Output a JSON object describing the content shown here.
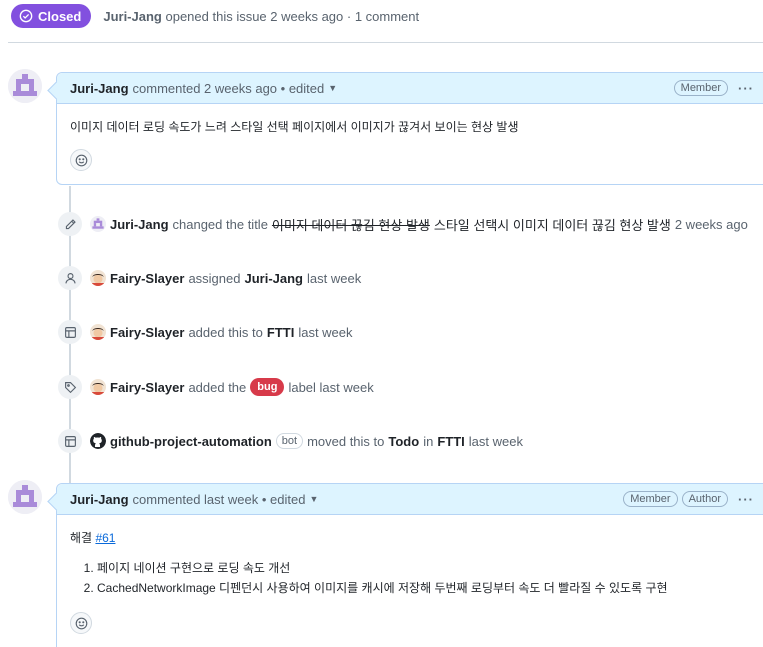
{
  "header": {
    "state": "Closed",
    "author": "Juri-Jang",
    "meta": "opened this issue 2 weeks ago · 1 comment"
  },
  "comments": [
    {
      "author": "Juri-Jang",
      "meta": "commented 2 weeks ago • edited",
      "labels": [
        "Member"
      ],
      "body": "이미지 데이터 로딩 속도가 느려 스타일 선택 페이지에서 이미지가 끊겨서 보이는 현상 발생"
    },
    {
      "author": "Juri-Jang",
      "meta": "commented last week • edited",
      "labels": [
        "Member",
        "Author"
      ],
      "intro": "해결",
      "link": "#61",
      "list": [
        "페이지 네이션 구현으로 로딩 속도 개선",
        "CachedNetworkImage 디펜던시 사용하여 이미지를 캐시에 저장해 두번째 로딩부터 속도 더 빨라질 수 있도록 구현"
      ]
    }
  ],
  "timeline": {
    "rename": {
      "actor": "Juri-Jang",
      "action": "changed the title",
      "old_title": "이미지 데이터 끊김 현상 발생",
      "new_title": "스타일 선택시 이미지 데이터 끊김 현상 발생",
      "time": "2 weeks ago"
    },
    "assign": {
      "actor": "Fairy-Slayer",
      "action": "assigned",
      "target": "Juri-Jang",
      "time": "last week"
    },
    "project": {
      "actor": "Fairy-Slayer",
      "action": "added this to",
      "target": "FTTI",
      "time": "last week"
    },
    "label": {
      "actor": "Fairy-Slayer",
      "action": "added the",
      "label": "bug",
      "suffix": "label last week"
    },
    "moved": {
      "actor": "github-project-automation",
      "bot": "bot",
      "action": "moved this to",
      "column": "Todo",
      "in": "in",
      "target": "FTTI",
      "time": "last week"
    }
  },
  "icons": {
    "state": "check-circle-icon",
    "rename": "pencil-icon",
    "assign": "person-icon",
    "project": "table-icon",
    "label": "tag-icon",
    "moved": "table-icon",
    "emoji": "smiley-icon"
  },
  "colors": {
    "closed": "#8250df",
    "bug": "#d73a4a",
    "link": "#0969da",
    "comment_header": "#ddf4ff"
  }
}
